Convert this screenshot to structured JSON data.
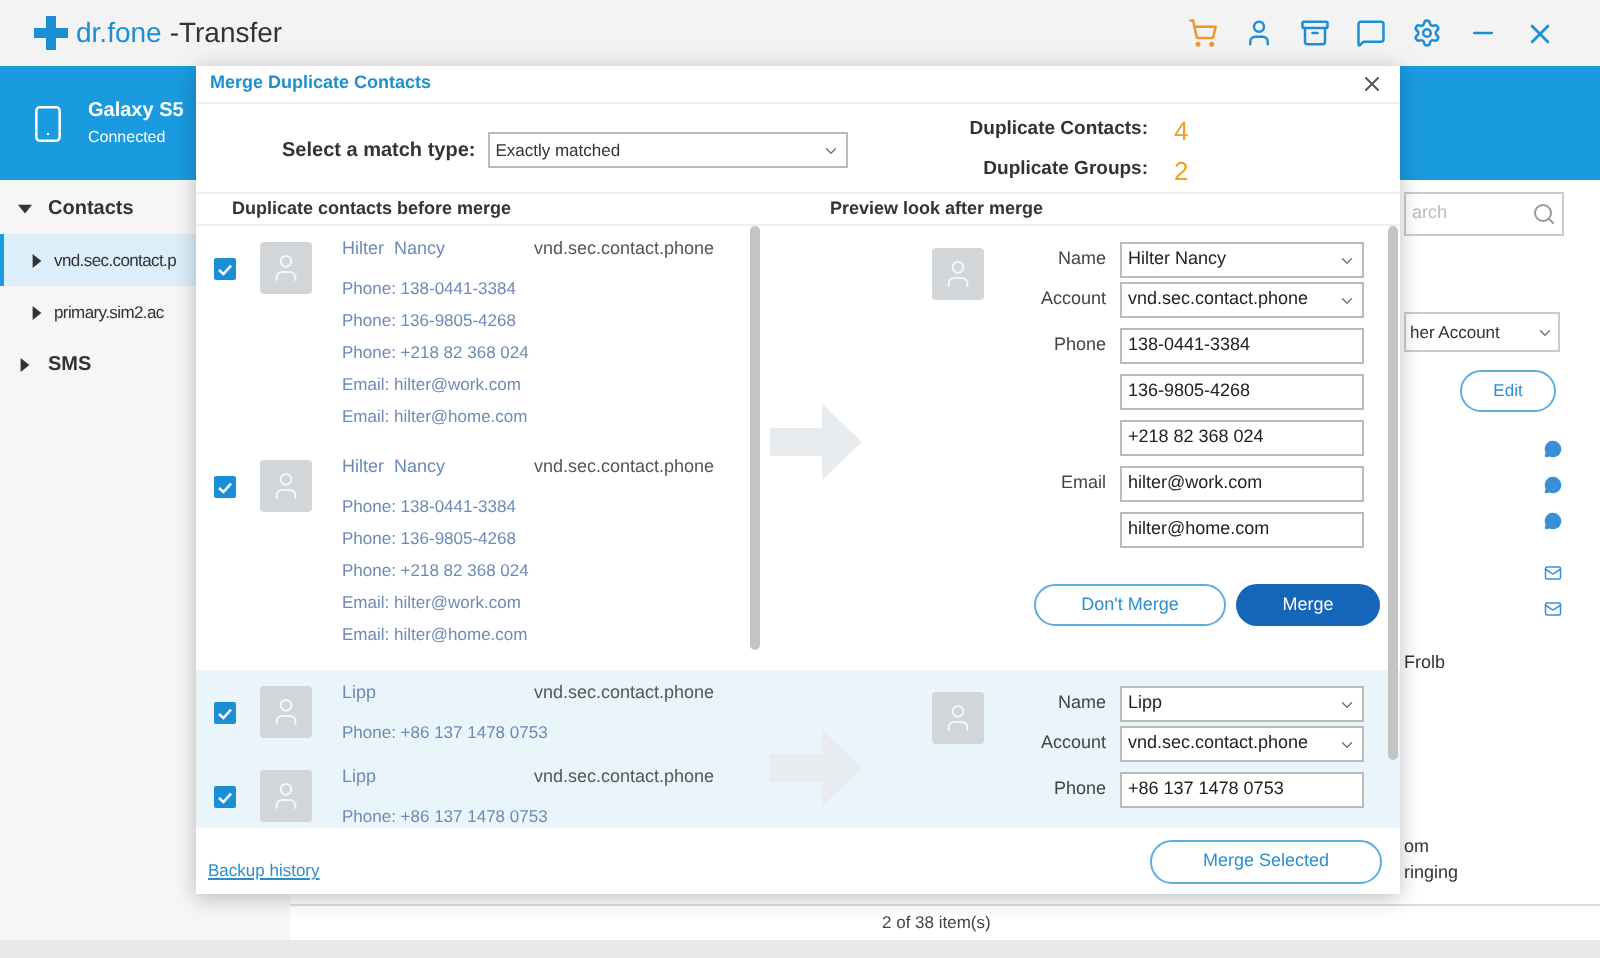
{
  "app": {
    "brand": "dr.fone",
    "title": "-Transfer"
  },
  "device": {
    "name": "Galaxy S5",
    "status": "Connected"
  },
  "sidebar": {
    "items": [
      {
        "label": "Contacts",
        "expanded": true,
        "selected": false,
        "children": [
          {
            "label": "vnd.sec.contact.p",
            "expanded": false,
            "selected": true
          },
          {
            "label": "primary.sim2.ac",
            "expanded": false,
            "selected": false
          }
        ]
      },
      {
        "label": "SMS",
        "expanded": false,
        "selected": false
      }
    ]
  },
  "main": {
    "search_placeholder": "arch",
    "account_select": "her Account",
    "edit_button": "Edit",
    "list_texts": [
      "Frolb",
      "om",
      "ringing"
    ],
    "status_bar": "2 of 38 item(s)"
  },
  "dialog": {
    "title": "Merge Duplicate Contacts",
    "match_label": "Select a match type:",
    "match_value": "Exactly matched",
    "stats": [
      {
        "label": "Duplicate Contacts:",
        "value": "4"
      },
      {
        "label": "Duplicate Groups:",
        "value": "2"
      }
    ],
    "left_heading": "Duplicate contacts before merge",
    "right_heading": "Preview look after merge",
    "groups": [
      {
        "highlighted": false,
        "contacts": [
          {
            "checked": true,
            "name": "Hilter  Nancy",
            "account": "vnd.sec.contact.phone",
            "details": [
              "Phone: 138-0441-3384",
              "Phone: 136-9805-4268",
              "Phone: +218 82 368 024",
              "Email: hilter@work.com",
              "Email: hilter@home.com"
            ]
          },
          {
            "checked": true,
            "name": "Hilter  Nancy",
            "account": "vnd.sec.contact.phone",
            "details": [
              "Phone: 138-0441-3384",
              "Phone: 136-9805-4268",
              "Phone: +218 82 368 024",
              "Email: hilter@work.com",
              "Email: hilter@home.com"
            ]
          }
        ],
        "fields": [
          {
            "label": "Name",
            "kind": "select",
            "value": "Hilter Nancy"
          },
          {
            "label": "Account",
            "kind": "select",
            "value": "vnd.sec.contact.phone"
          },
          {
            "label": "Phone",
            "kind": "input",
            "value": "138-0441-3384"
          },
          {
            "kind": "input",
            "value": "136-9805-4268"
          },
          {
            "kind": "input",
            "value": "+218 82 368 024"
          },
          {
            "label": "Email",
            "kind": "input",
            "value": "hilter@work.com"
          },
          {
            "kind": "input",
            "value": "hilter@home.com"
          }
        ],
        "actions": [
          {
            "label": "Don't Merge",
            "kind": "outline"
          },
          {
            "label": "Merge",
            "kind": "primary"
          }
        ]
      },
      {
        "highlighted": true,
        "contacts": [
          {
            "checked": true,
            "name": "Lipp",
            "account": "vnd.sec.contact.phone",
            "details": [
              "Phone: +86 137 1478 0753"
            ]
          },
          {
            "checked": true,
            "name": "Lipp",
            "account": "vnd.sec.contact.phone",
            "details": [
              "Phone: +86 137 1478 0753"
            ]
          }
        ],
        "fields": [
          {
            "label": "Name",
            "kind": "select",
            "value": "Lipp"
          },
          {
            "label": "Account",
            "kind": "select",
            "value": "vnd.sec.contact.phone"
          },
          {
            "label": "Phone",
            "kind": "input",
            "value": "+86 137 1478 0753"
          }
        ]
      }
    ],
    "footer": {
      "link": "Backup history",
      "button": "Merge Selected"
    }
  }
}
